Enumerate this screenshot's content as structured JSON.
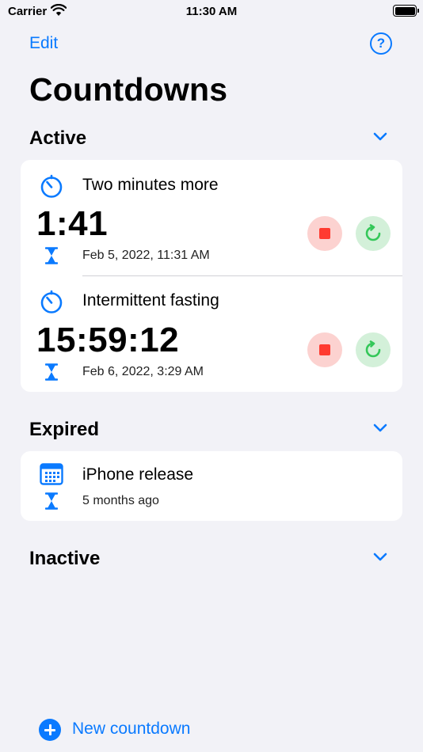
{
  "status_bar": {
    "carrier": "Carrier",
    "time": "11:30 AM"
  },
  "nav": {
    "edit_label": "Edit",
    "help_label": "?"
  },
  "page_title": "Countdowns",
  "sections": {
    "active": {
      "title": "Active",
      "items": [
        {
          "title": "Two minutes more",
          "time": "1:41",
          "end_date": "Feb 5, 2022, 11:31 AM"
        },
        {
          "title": "Intermittent fasting",
          "time": "15:59:12",
          "end_date": "Feb 6, 2022, 3:29 AM"
        }
      ]
    },
    "expired": {
      "title": "Expired",
      "items": [
        {
          "title": "iPhone release",
          "subtitle": "5 months ago"
        }
      ]
    },
    "inactive": {
      "title": "Inactive"
    }
  },
  "new_countdown_label": "New countdown",
  "colors": {
    "accent": "#0a7aff",
    "stop": "#ff3b30",
    "restart": "#34c759",
    "background": "#f2f2f7"
  },
  "icons": [
    "wifi-icon",
    "battery-icon",
    "help-icon",
    "chevron-down-icon",
    "timer-icon",
    "hourglass-icon",
    "calendar-icon",
    "stop-icon",
    "restart-icon",
    "plus-circle-icon"
  ]
}
